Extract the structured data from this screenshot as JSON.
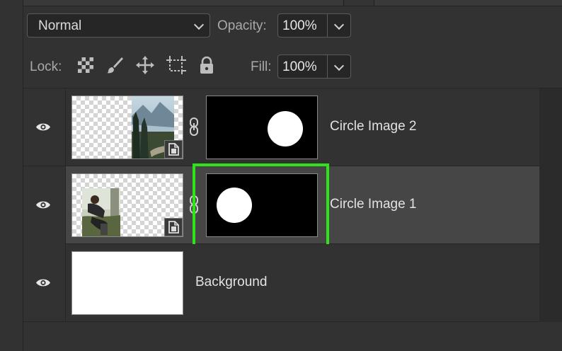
{
  "blend": {
    "mode": "Normal"
  },
  "opacity": {
    "label": "Opacity:",
    "value": "100%"
  },
  "lock": {
    "label": "Lock:",
    "icons": [
      "lock-transparent-pixels-icon",
      "lock-image-pixels-icon",
      "lock-position-icon",
      "lock-artboard-icon",
      "lock-all-icon"
    ]
  },
  "fill": {
    "label": "Fill:",
    "value": "100%"
  },
  "layers": [
    {
      "name": "Circle Image 2",
      "visible": true,
      "selected": false,
      "has_mask": true,
      "mask_circle_side": "right"
    },
    {
      "name": "Circle Image 1",
      "visible": true,
      "selected": true,
      "has_mask": true,
      "mask_circle_side": "left",
      "highlight_color": "#2fe31a"
    },
    {
      "name": "Background",
      "visible": true,
      "selected": false,
      "has_mask": false
    }
  ]
}
